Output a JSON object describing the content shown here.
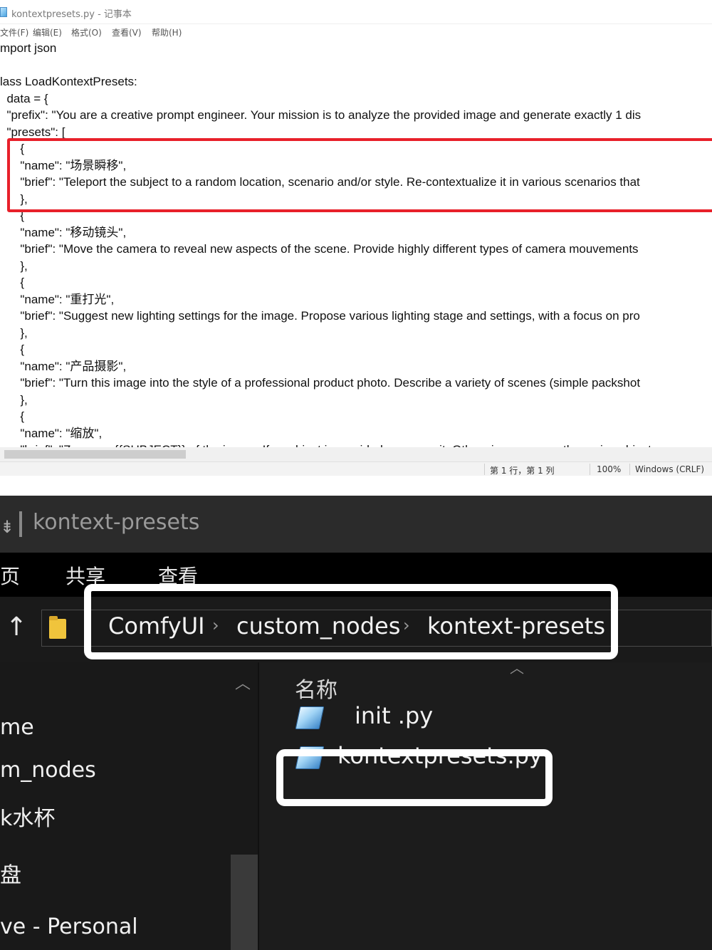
{
  "notepad": {
    "title": "kontextpresets.py - 记事本",
    "menu": [
      "文件(F)",
      "编辑(E)",
      "格式(O)",
      "查看(V)",
      "帮助(H)"
    ],
    "lines": [
      "mport json",
      "",
      "lass LoadKontextPresets:",
      "  data = {",
      "  \"prefix\": \"You are a creative prompt engineer. Your mission is to analyze the provided image and generate exactly 1 dis",
      "  \"presets\": [",
      "      {",
      "      \"name\": \"场景瞬移\",",
      "      \"brief\": \"Teleport the subject to a random location, scenario and/or style. Re-contextualize it in various scenarios that",
      "      },",
      "      {",
      "      \"name\": \"移动镜头\",",
      "      \"brief\": \"Move the camera to reveal new aspects of the scene. Provide highly different types of camera mouvements",
      "      },",
      "      {",
      "      \"name\": \"重打光\",",
      "      \"brief\": \"Suggest new lighting settings for the image. Propose various lighting stage and settings, with a focus on pro",
      "      },",
      "      {",
      "      \"name\": \"产品摄影\",",
      "      \"brief\": \"Turn this image into the style of a professional product photo. Describe a variety of scenes (simple packshot",
      "      },",
      "      {",
      "      \"name\": \"缩放\",",
      "      \"brief\": \"Zoom on {{SUBJECT}} of the image. If a subject is provided, zoom on it. Otherwise, zoom on the main subject o"
    ],
    "status": {
      "position": "第 1 行，第 1 列",
      "zoom": "100%",
      "line_ending": "Windows (CRLF)"
    }
  },
  "explorer": {
    "title": "kontext-presets",
    "tabs": [
      "页",
      "共享",
      "查看"
    ],
    "breadcrumb": [
      "ComfyUI",
      "custom_nodes",
      "kontext-presets"
    ],
    "column_header": "名称",
    "nav_items": [
      "me",
      "m_nodes",
      "k水杯",
      "盘",
      "ve - Personal"
    ],
    "files": [
      "init .py",
      "kontextpresets.py"
    ]
  },
  "highlight_colors": {
    "notepad_highlight": "#e8202a",
    "explorer_highlight": "#ffffff"
  }
}
